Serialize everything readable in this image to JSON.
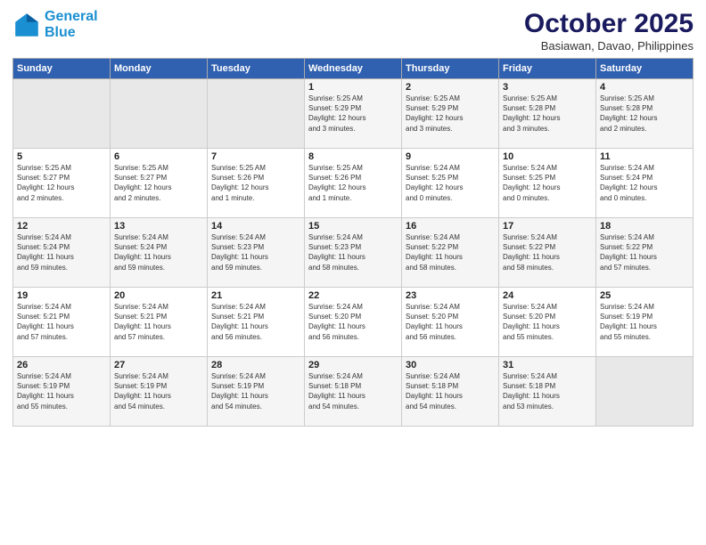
{
  "header": {
    "logo_line1": "General",
    "logo_line2": "Blue",
    "month": "October 2025",
    "location": "Basiawan, Davao, Philippines"
  },
  "weekdays": [
    "Sunday",
    "Monday",
    "Tuesday",
    "Wednesday",
    "Thursday",
    "Friday",
    "Saturday"
  ],
  "weeks": [
    [
      {
        "day": "",
        "info": ""
      },
      {
        "day": "",
        "info": ""
      },
      {
        "day": "",
        "info": ""
      },
      {
        "day": "1",
        "info": "Sunrise: 5:25 AM\nSunset: 5:29 PM\nDaylight: 12 hours\nand 3 minutes."
      },
      {
        "day": "2",
        "info": "Sunrise: 5:25 AM\nSunset: 5:29 PM\nDaylight: 12 hours\nand 3 minutes."
      },
      {
        "day": "3",
        "info": "Sunrise: 5:25 AM\nSunset: 5:28 PM\nDaylight: 12 hours\nand 3 minutes."
      },
      {
        "day": "4",
        "info": "Sunrise: 5:25 AM\nSunset: 5:28 PM\nDaylight: 12 hours\nand 2 minutes."
      }
    ],
    [
      {
        "day": "5",
        "info": "Sunrise: 5:25 AM\nSunset: 5:27 PM\nDaylight: 12 hours\nand 2 minutes."
      },
      {
        "day": "6",
        "info": "Sunrise: 5:25 AM\nSunset: 5:27 PM\nDaylight: 12 hours\nand 2 minutes."
      },
      {
        "day": "7",
        "info": "Sunrise: 5:25 AM\nSunset: 5:26 PM\nDaylight: 12 hours\nand 1 minute."
      },
      {
        "day": "8",
        "info": "Sunrise: 5:25 AM\nSunset: 5:26 PM\nDaylight: 12 hours\nand 1 minute."
      },
      {
        "day": "9",
        "info": "Sunrise: 5:24 AM\nSunset: 5:25 PM\nDaylight: 12 hours\nand 0 minutes."
      },
      {
        "day": "10",
        "info": "Sunrise: 5:24 AM\nSunset: 5:25 PM\nDaylight: 12 hours\nand 0 minutes."
      },
      {
        "day": "11",
        "info": "Sunrise: 5:24 AM\nSunset: 5:24 PM\nDaylight: 12 hours\nand 0 minutes."
      }
    ],
    [
      {
        "day": "12",
        "info": "Sunrise: 5:24 AM\nSunset: 5:24 PM\nDaylight: 11 hours\nand 59 minutes."
      },
      {
        "day": "13",
        "info": "Sunrise: 5:24 AM\nSunset: 5:24 PM\nDaylight: 11 hours\nand 59 minutes."
      },
      {
        "day": "14",
        "info": "Sunrise: 5:24 AM\nSunset: 5:23 PM\nDaylight: 11 hours\nand 59 minutes."
      },
      {
        "day": "15",
        "info": "Sunrise: 5:24 AM\nSunset: 5:23 PM\nDaylight: 11 hours\nand 58 minutes."
      },
      {
        "day": "16",
        "info": "Sunrise: 5:24 AM\nSunset: 5:22 PM\nDaylight: 11 hours\nand 58 minutes."
      },
      {
        "day": "17",
        "info": "Sunrise: 5:24 AM\nSunset: 5:22 PM\nDaylight: 11 hours\nand 58 minutes."
      },
      {
        "day": "18",
        "info": "Sunrise: 5:24 AM\nSunset: 5:22 PM\nDaylight: 11 hours\nand 57 minutes."
      }
    ],
    [
      {
        "day": "19",
        "info": "Sunrise: 5:24 AM\nSunset: 5:21 PM\nDaylight: 11 hours\nand 57 minutes."
      },
      {
        "day": "20",
        "info": "Sunrise: 5:24 AM\nSunset: 5:21 PM\nDaylight: 11 hours\nand 57 minutes."
      },
      {
        "day": "21",
        "info": "Sunrise: 5:24 AM\nSunset: 5:21 PM\nDaylight: 11 hours\nand 56 minutes."
      },
      {
        "day": "22",
        "info": "Sunrise: 5:24 AM\nSunset: 5:20 PM\nDaylight: 11 hours\nand 56 minutes."
      },
      {
        "day": "23",
        "info": "Sunrise: 5:24 AM\nSunset: 5:20 PM\nDaylight: 11 hours\nand 56 minutes."
      },
      {
        "day": "24",
        "info": "Sunrise: 5:24 AM\nSunset: 5:20 PM\nDaylight: 11 hours\nand 55 minutes."
      },
      {
        "day": "25",
        "info": "Sunrise: 5:24 AM\nSunset: 5:19 PM\nDaylight: 11 hours\nand 55 minutes."
      }
    ],
    [
      {
        "day": "26",
        "info": "Sunrise: 5:24 AM\nSunset: 5:19 PM\nDaylight: 11 hours\nand 55 minutes."
      },
      {
        "day": "27",
        "info": "Sunrise: 5:24 AM\nSunset: 5:19 PM\nDaylight: 11 hours\nand 54 minutes."
      },
      {
        "day": "28",
        "info": "Sunrise: 5:24 AM\nSunset: 5:19 PM\nDaylight: 11 hours\nand 54 minutes."
      },
      {
        "day": "29",
        "info": "Sunrise: 5:24 AM\nSunset: 5:18 PM\nDaylight: 11 hours\nand 54 minutes."
      },
      {
        "day": "30",
        "info": "Sunrise: 5:24 AM\nSunset: 5:18 PM\nDaylight: 11 hours\nand 54 minutes."
      },
      {
        "day": "31",
        "info": "Sunrise: 5:24 AM\nSunset: 5:18 PM\nDaylight: 11 hours\nand 53 minutes."
      },
      {
        "day": "",
        "info": ""
      }
    ]
  ]
}
